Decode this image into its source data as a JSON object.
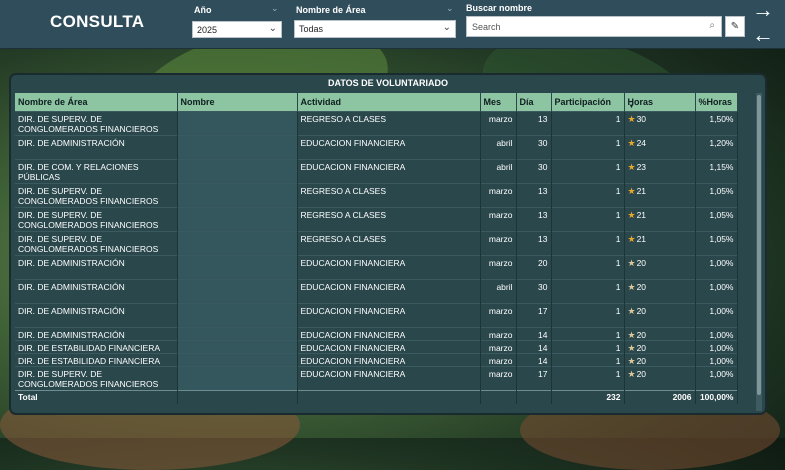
{
  "header": {
    "title": "CONSULTA",
    "year": {
      "label": "Año",
      "value": "2025"
    },
    "area": {
      "label": "Nombre de Área",
      "value": "Todas"
    },
    "search": {
      "label": "Buscar nombre",
      "placeholder": "Search"
    }
  },
  "table": {
    "title": "DATOS DE VOLUNTARIADO",
    "columns": [
      "Nombre de Área",
      "Nombre",
      "Actividad",
      "Mes",
      "Día",
      "Participación",
      "Horas",
      "%Horas"
    ],
    "rows": [
      {
        "area": "DIR. DE SUPERV. DE CONGLOMERADOS FINANCIEROS",
        "nombre": "",
        "actividad": "REGRESO A CLASES",
        "mes": "marzo",
        "dia": "13",
        "part": "1",
        "horas": "30",
        "star": "full",
        "pct": "1,50%"
      },
      {
        "area": "DIR. DE ADMINISTRACIÓN",
        "nombre": "",
        "actividad": "EDUCACION FINANCIERA",
        "mes": "abril",
        "dia": "30",
        "part": "1",
        "horas": "24",
        "star": "full",
        "pct": "1,20%"
      },
      {
        "area": "DIR. DE COM. Y RELACIONES PÚBLICAS",
        "nombre": "",
        "actividad": "EDUCACION FINANCIERA",
        "mes": "abril",
        "dia": "30",
        "part": "1",
        "horas": "23",
        "star": "full",
        "pct": "1,15%"
      },
      {
        "area": "DIR. DE SUPERV. DE CONGLOMERADOS FINANCIEROS",
        "nombre": "",
        "actividad": "REGRESO A CLASES",
        "mes": "marzo",
        "dia": "13",
        "part": "1",
        "horas": "21",
        "star": "full",
        "pct": "1,05%"
      },
      {
        "area": "DIR. DE SUPERV. DE CONGLOMERADOS FINANCIEROS",
        "nombre": "",
        "actividad": "REGRESO A CLASES",
        "mes": "marzo",
        "dia": "13",
        "part": "1",
        "horas": "21",
        "star": "full",
        "pct": "1,05%"
      },
      {
        "area": "DIR. DE SUPERV. DE CONGLOMERADOS FINANCIEROS",
        "nombre": "",
        "actividad": "REGRESO A CLASES",
        "mes": "marzo",
        "dia": "13",
        "part": "1",
        "horas": "21",
        "star": "full",
        "pct": "1,05%"
      },
      {
        "area": "DIR. DE ADMINISTRACIÓN",
        "nombre": "",
        "actividad": "EDUCACION FINANCIERA",
        "mes": "marzo",
        "dia": "20",
        "part": "1",
        "horas": "20",
        "star": "half",
        "pct": "1,00%"
      },
      {
        "area": "DIR. DE ADMINISTRACIÓN",
        "nombre": "",
        "actividad": "EDUCACION FINANCIERA",
        "mes": "abril",
        "dia": "30",
        "part": "1",
        "horas": "20",
        "star": "half",
        "pct": "1,00%"
      },
      {
        "area": "DIR. DE ADMINISTRACIÓN",
        "nombre": "",
        "actividad": "EDUCACION FINANCIERA",
        "mes": "marzo",
        "dia": "17",
        "part": "1",
        "horas": "20",
        "star": "half",
        "pct": "1,00%"
      },
      {
        "area": "DIR. DE ADMINISTRACIÓN",
        "nombre": "",
        "actividad": "EDUCACION FINANCIERA",
        "mes": "marzo",
        "dia": "14",
        "part": "1",
        "horas": "20",
        "star": "half",
        "pct": "1,00%"
      },
      {
        "area": "DIR. DE ESTABILIDAD FINANCIERA",
        "nombre": "",
        "actividad": "EDUCACION FINANCIERA",
        "mes": "marzo",
        "dia": "14",
        "part": "1",
        "horas": "20",
        "star": "half",
        "pct": "1,00%"
      },
      {
        "area": "DIR. DE ESTABILIDAD FINANCIERA",
        "nombre": "",
        "actividad": "EDUCACION FINANCIERA",
        "mes": "marzo",
        "dia": "14",
        "part": "1",
        "horas": "20",
        "star": "half",
        "pct": "1,00%"
      },
      {
        "area": "DIR. DE SUPERV. DE CONGLOMERADOS FINANCIEROS",
        "nombre": "",
        "actividad": "EDUCACION FINANCIERA",
        "mes": "marzo",
        "dia": "17",
        "part": "1",
        "horas": "20",
        "star": "half",
        "pct": "1,00%"
      }
    ],
    "total": {
      "label": "Total",
      "part": "232",
      "horas": "2006",
      "pct": "100,00%"
    }
  },
  "colors": {
    "header_bg": "#2f4d5a",
    "table_header": "#8dc4a1",
    "panel_bg": "#2a474c",
    "star": "#e8a72a"
  },
  "icons": {
    "search": "search-icon",
    "eraser": "eraser-icon",
    "forward": "arrow-right-icon",
    "back": "arrow-left-icon",
    "sort": "sort-desc-icon"
  }
}
